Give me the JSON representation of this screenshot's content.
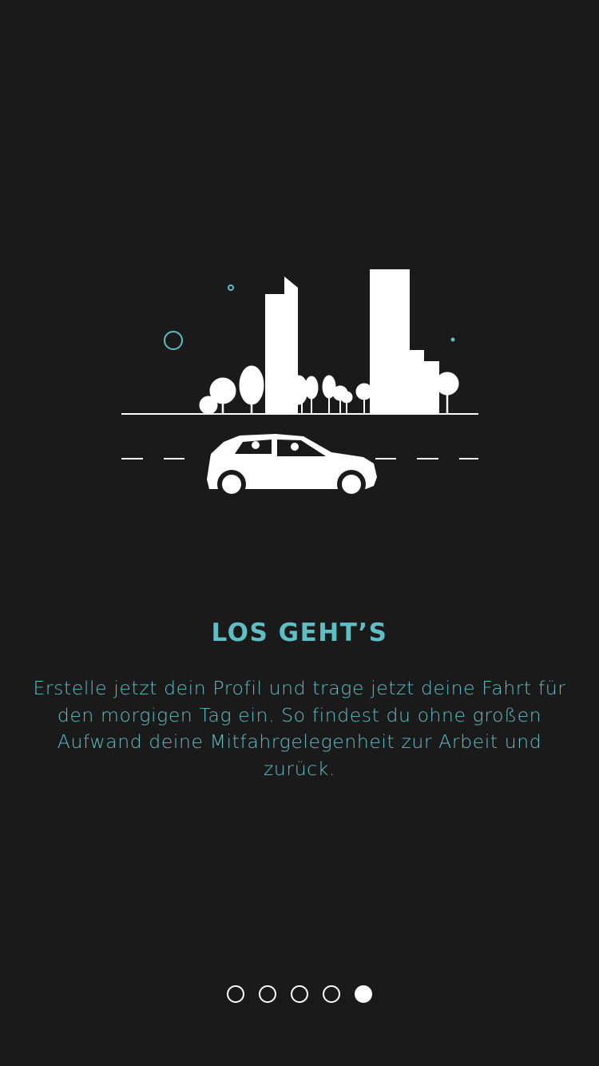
{
  "onboarding": {
    "title": "LOS GEHT’S",
    "description": "Erstelle jetzt dein Profil und trage jetzt deine Fahrt für den morgigen Tag ein. So findest du ohne großen Aufwand deine Mitfahrgelegenheit zur Arbeit und zurück.",
    "illustration_icon": "city-car-illustration",
    "accent_color": "#5fbdc4",
    "background_color": "#1a1a1a"
  },
  "pager": {
    "total_pages": 5,
    "active_page": 5,
    "dot_icon": "page-dot-icon"
  }
}
